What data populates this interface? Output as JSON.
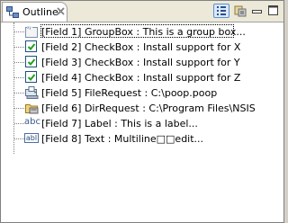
{
  "view": {
    "title": "Outline",
    "close_icon": "close-icon",
    "toolbar": {
      "sort_icon": "sort-alphabetical-icon",
      "filter_icon": "filter-icon",
      "minimize_icon": "minimize-icon",
      "maximize_icon": "maximize-icon"
    }
  },
  "tree": {
    "items": [
      {
        "label": "[Field 1] GroupBox : This is a group box...",
        "icon": "groupbox-icon",
        "selected": true
      },
      {
        "label": "[Field 2] CheckBox : Install support for X",
        "icon": "checkbox-checked-icon"
      },
      {
        "label": "[Field 3] CheckBox : Install support for Y",
        "icon": "checkbox-checked-icon"
      },
      {
        "label": "[Field 4] CheckBox : Install support for Z",
        "icon": "checkbox-checked-icon"
      },
      {
        "label": "[Field 5] FileRequest : C:\\poop.poop",
        "icon": "file-request-icon"
      },
      {
        "label": "[Field 6] DirRequest : C:\\Program Files\\NSIS",
        "icon": "dir-request-icon"
      },
      {
        "label": "[Field 7] Label : This is a label...",
        "icon": "label-abc-icon",
        "icon_text": "abc"
      },
      {
        "label": "[Field 8] Text : Multiline□□edit...",
        "icon": "text-field-icon",
        "icon_text": "abl"
      }
    ]
  },
  "colors": {
    "header_bg": "#ece9d8",
    "selection_border": "#000000",
    "checkbox_border": "#1c5180",
    "check_mark": "#21a121"
  }
}
